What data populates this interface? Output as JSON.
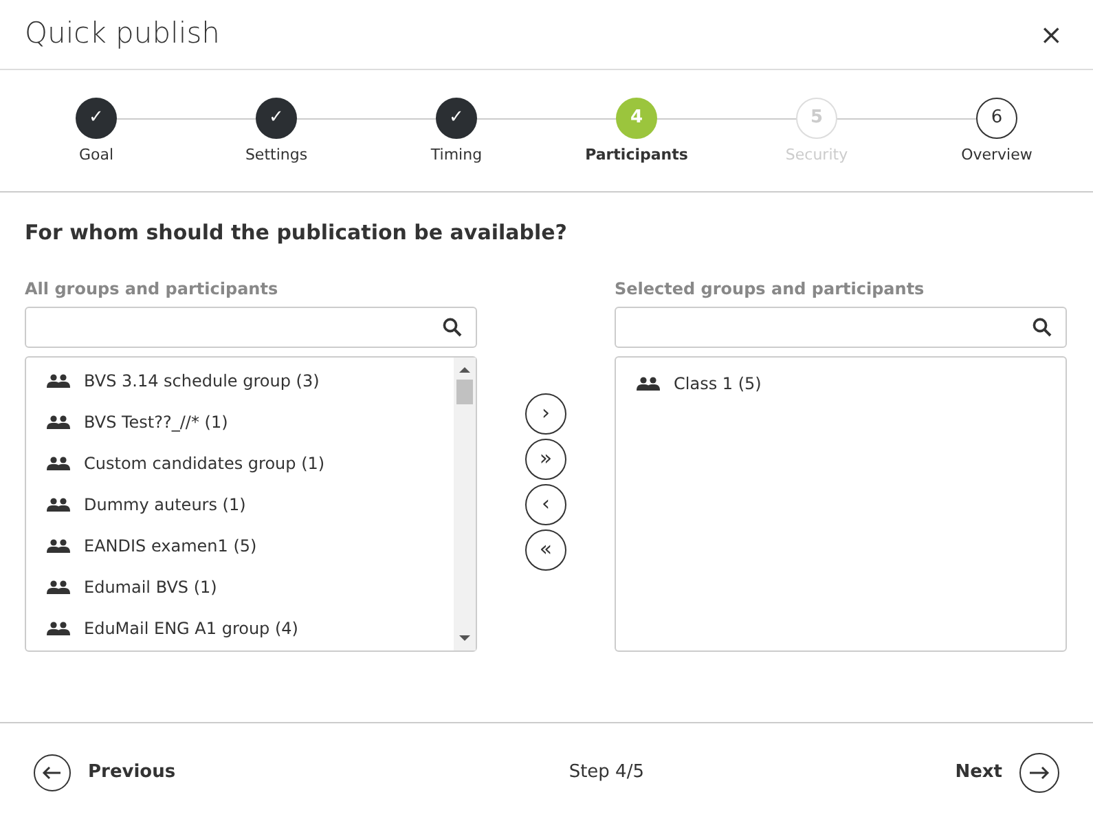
{
  "window": {
    "title": "Quick publish",
    "close": "×"
  },
  "steps": [
    {
      "label": "Goal",
      "marker": "✓",
      "completed": true,
      "selected": false,
      "disabled": false
    },
    {
      "label": "Settings",
      "marker": "✓",
      "completed": true,
      "selected": false,
      "disabled": false
    },
    {
      "label": "Timing",
      "marker": "✓",
      "completed": true,
      "selected": false,
      "disabled": false
    },
    {
      "label": "Participants",
      "marker": "4",
      "completed": false,
      "selected": true,
      "disabled": false
    },
    {
      "label": "Security",
      "marker": "5",
      "completed": false,
      "selected": false,
      "disabled": true
    },
    {
      "label": "Overview",
      "marker": "6",
      "completed": false,
      "selected": false,
      "disabled": false
    }
  ],
  "question": "For whom should the publication be available?",
  "available": {
    "heading": "All groups and participants",
    "items": [
      "BVS 3.14 schedule group (3)",
      "BVS Test??_//* (1)",
      "Custom candidates group (1)",
      "Dummy auteurs (1)",
      "EANDIS examen1 (5)",
      "Edumail BVS (1)",
      "EduMail ENG A1 group (4)"
    ]
  },
  "transfer_buttons": [
    "›",
    "»",
    "‹",
    "«"
  ],
  "selected": {
    "heading": "Selected groups and participants",
    "items": [
      "Class 1 (5)"
    ]
  },
  "footer": {
    "previous": "Previous",
    "step": "Step 4/5",
    "next": "Next"
  }
}
